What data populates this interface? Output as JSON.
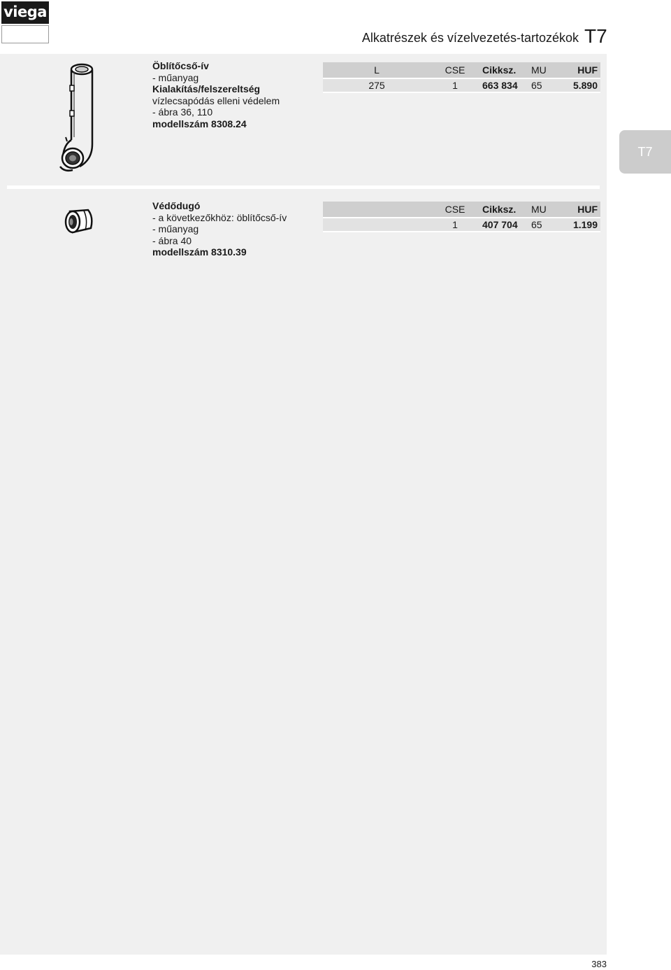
{
  "logo": {
    "text": "viega"
  },
  "header": {
    "title": "Alkatrészek és vízelvezetés-tartozékok",
    "code": "T7"
  },
  "side_tab": "T7",
  "products": [
    {
      "lines": [
        {
          "text": "Öblítőcső-ív",
          "bold": true
        },
        {
          "text": "-  műanyag",
          "bold": false
        },
        {
          "text": "Kialakítás/felszereltség",
          "bold": true
        },
        {
          "text": "vízlecsapódás elleni védelem",
          "bold": false
        },
        {
          "text": "-  ábra 36, 110",
          "bold": false
        },
        {
          "text": "modellszám 8308.24",
          "bold": true
        }
      ],
      "table": {
        "headers": [
          "L",
          "CSE",
          "Cikksz.",
          "MU",
          "HUF"
        ],
        "rows": [
          [
            "275",
            "1",
            "663 834",
            "65",
            "5.890"
          ]
        ]
      }
    },
    {
      "lines": [
        {
          "text": "Védődugó",
          "bold": true
        },
        {
          "text": "-  a következőkhöz: öblítőcső-ív",
          "bold": false
        },
        {
          "text": "-  műanyag",
          "bold": false
        },
        {
          "text": "-  ábra 40",
          "bold": false
        },
        {
          "text": "modellszám 8310.39",
          "bold": true
        }
      ],
      "table": {
        "headers": [
          "",
          "CSE",
          "Cikksz.",
          "MU",
          "HUF"
        ],
        "rows": [
          [
            "",
            "1",
            "407 704",
            "65",
            "1.199"
          ]
        ]
      }
    }
  ],
  "footer": {
    "page_number": "383"
  }
}
